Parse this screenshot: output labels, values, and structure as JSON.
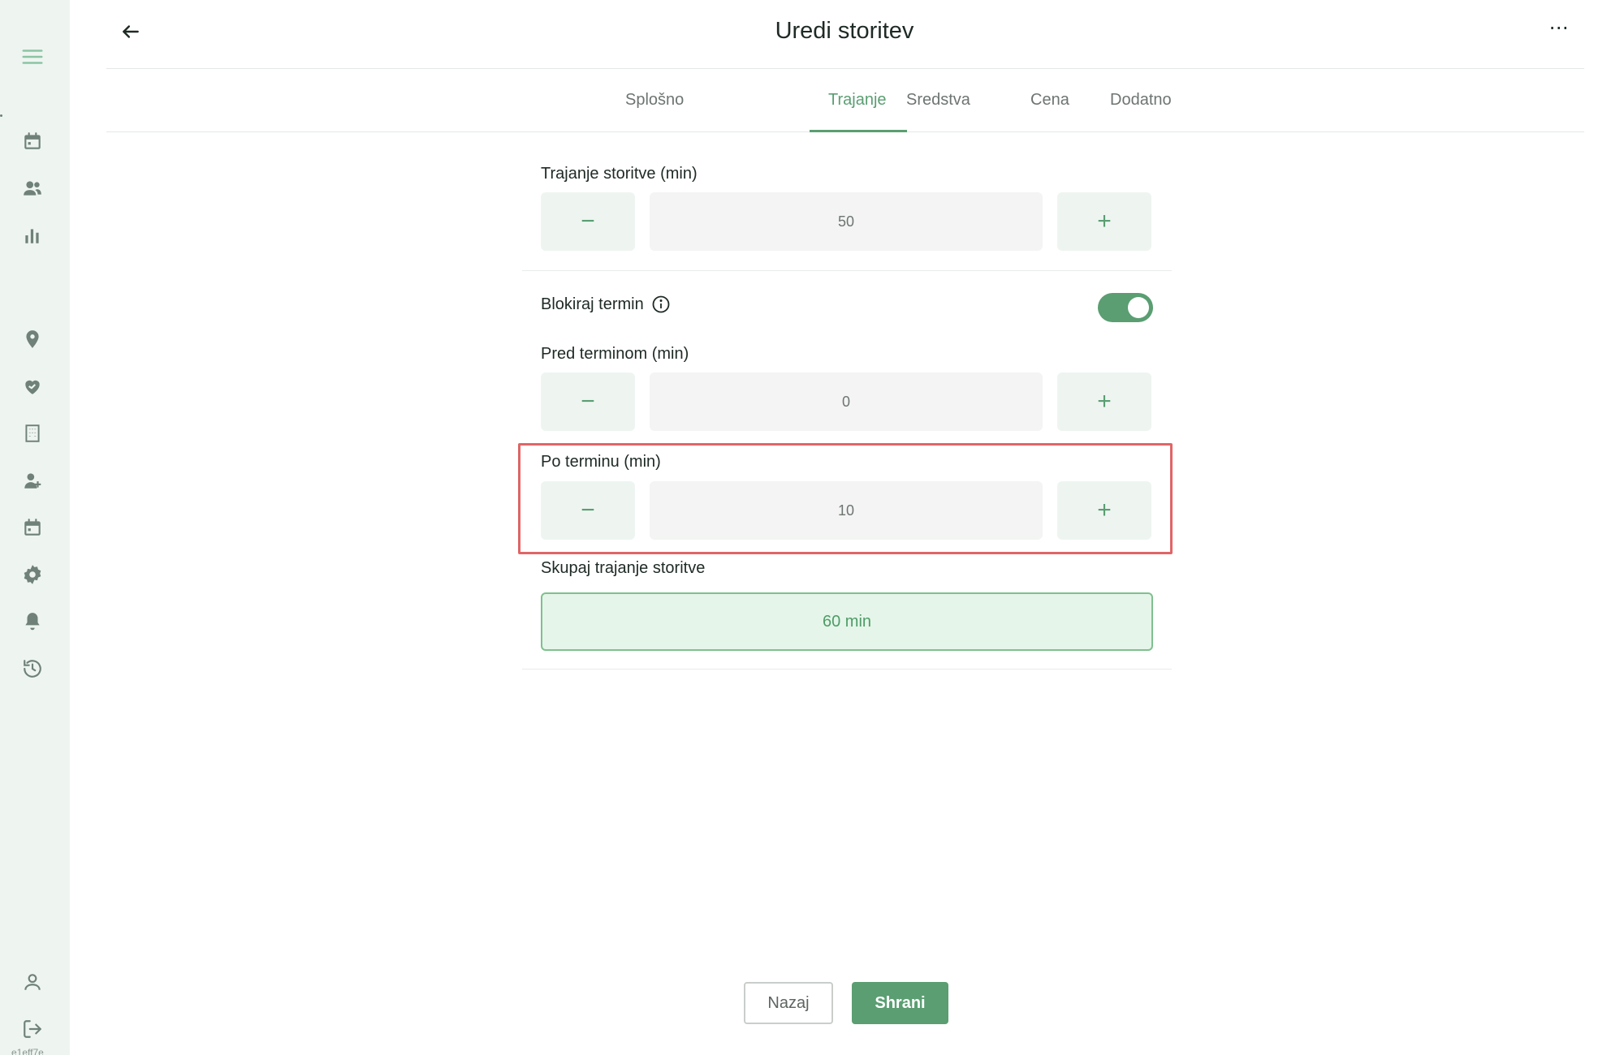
{
  "header": {
    "title": "Uredi storitev",
    "more": "⋯"
  },
  "tabs": [
    {
      "label": "Splošno",
      "active": false
    },
    {
      "label": "Trajanje",
      "active": true
    },
    {
      "label": "Sredstva",
      "active": false
    },
    {
      "label": "Cena",
      "active": false
    },
    {
      "label": "Dodatno",
      "active": false
    }
  ],
  "form": {
    "duration": {
      "label": "Trajanje storitve (min)",
      "value": "50"
    },
    "block": {
      "label": "Blokiraj termin",
      "enabled": true
    },
    "before": {
      "label": "Pred terminom (min)",
      "value": "0"
    },
    "after": {
      "label": "Po terminu (min)",
      "value": "10"
    },
    "total": {
      "label": "Skupaj trajanje storitve",
      "value": "60 min"
    },
    "minus": "−",
    "plus": "+"
  },
  "footer": {
    "back_label": "Nazaj",
    "save_label": "Shrani"
  },
  "sidebar": {
    "version_hash": "e1eff7e"
  },
  "colors": {
    "accent": "#5a9e72",
    "sidebar_bg": "#eef5f1",
    "highlight": "#e06566"
  }
}
